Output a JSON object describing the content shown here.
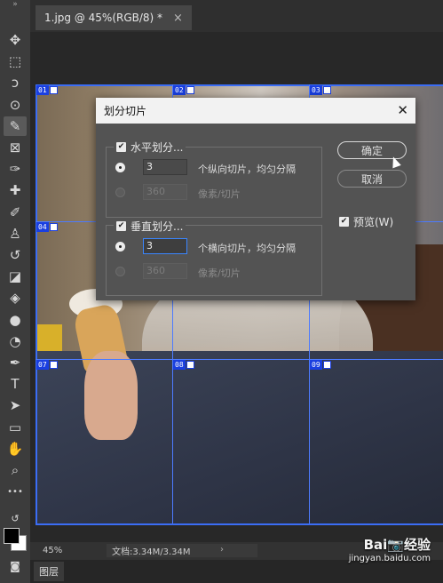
{
  "document": {
    "tab_title": "1.jpg @ 45%(RGB/8) *",
    "close_glyph": "×"
  },
  "toolbar": {
    "collapse": "»",
    "tools": [
      {
        "name": "move-tool",
        "glyph": "✥"
      },
      {
        "name": "marquee-tool",
        "glyph": "⬚"
      },
      {
        "name": "lasso-tool",
        "glyph": "ↄ"
      },
      {
        "name": "quick-select-tool",
        "glyph": "⊙"
      },
      {
        "name": "slice-tool",
        "glyph": "✎"
      },
      {
        "name": "frame-tool",
        "glyph": "⊠"
      },
      {
        "name": "eyedropper-tool",
        "glyph": "✑"
      },
      {
        "name": "healing-tool",
        "glyph": "✚"
      },
      {
        "name": "brush-tool",
        "glyph": "✐"
      },
      {
        "name": "stamp-tool",
        "glyph": "♙"
      },
      {
        "name": "history-brush-tool",
        "glyph": "↺"
      },
      {
        "name": "eraser-tool",
        "glyph": "◪"
      },
      {
        "name": "paint-bucket-tool",
        "glyph": "◈"
      },
      {
        "name": "blur-tool",
        "glyph": "●"
      },
      {
        "name": "dodge-tool",
        "glyph": "◔"
      },
      {
        "name": "pen-tool",
        "glyph": "✒"
      },
      {
        "name": "type-tool",
        "glyph": "T"
      },
      {
        "name": "path-select-tool",
        "glyph": "➤"
      },
      {
        "name": "rectangle-tool",
        "glyph": "▭"
      },
      {
        "name": "hand-tool",
        "glyph": "✋"
      },
      {
        "name": "zoom-tool",
        "glyph": "⌕"
      },
      {
        "name": "more-tools",
        "glyph": "•••"
      }
    ],
    "swap_glyph": "↺",
    "mask_glyph": "◙",
    "foreground_color": "#000000",
    "background_color": "#ffffff"
  },
  "slices": {
    "labels": [
      "01",
      "02",
      "03",
      "04",
      "07",
      "08",
      "09"
    ],
    "accent": "#1a3fe0"
  },
  "dialog": {
    "title": "划分切片",
    "close_glyph": "✕",
    "horizontal": {
      "checkbox_label": "水平划分...",
      "checked": true,
      "option1_value": "3",
      "option1_label": "个纵向切片，均匀分隔",
      "option2_value": "360",
      "option2_label": "像素/切片"
    },
    "vertical": {
      "checkbox_label": "垂直划分...",
      "checked": true,
      "option1_value": "3",
      "option1_label": "个横向切片，均匀分隔",
      "option2_value": "360",
      "option2_label": "像素/切片"
    },
    "ok_label": "确定",
    "cancel_label": "取消",
    "preview_label": "预览(W)",
    "preview_checked": true,
    "check_glyph": "✔"
  },
  "statusbar": {
    "zoom": "45%",
    "doc_info": "文档:3.34M/3.34M",
    "chevron": "›"
  },
  "panels": {
    "layers_tab": "图层"
  },
  "watermark": {
    "brand": "Bai📷经验",
    "url": "jingyan.baidu.com"
  }
}
